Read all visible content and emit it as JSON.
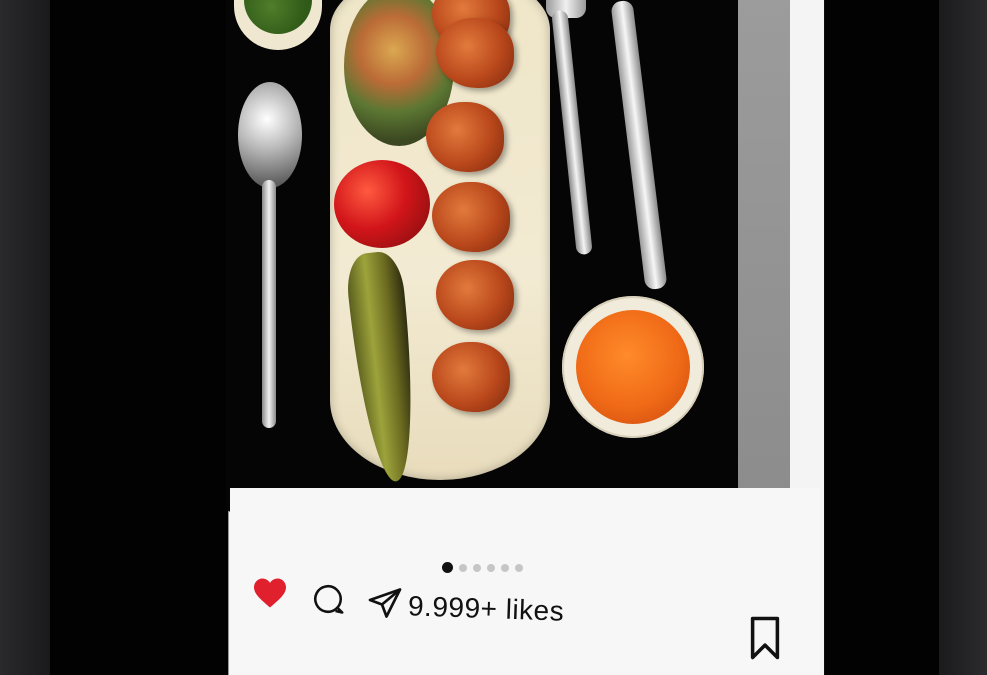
{
  "post": {
    "image_description_icon": "food-photo",
    "carousel": {
      "total": 6,
      "active_index": 0
    },
    "actions": {
      "like_icon": "heart-icon",
      "comment_icon": "comment-icon",
      "share_icon": "send-icon",
      "save_icon": "bookmark-icon",
      "liked": true
    },
    "likes_text": "9.999+ likes",
    "colors": {
      "heart": "#e0202d",
      "text": "#111111",
      "card_bg": "#f7f7f7"
    }
  }
}
